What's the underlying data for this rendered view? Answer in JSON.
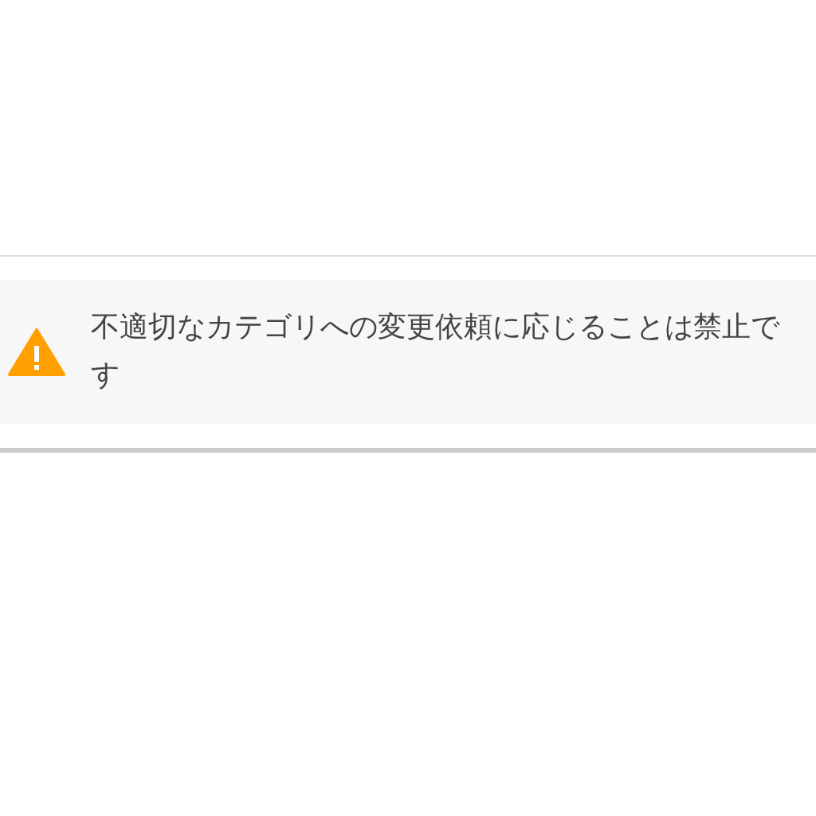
{
  "notice": {
    "message": "不適切なカテゴリへの変更依頼に応じることは禁止です"
  }
}
